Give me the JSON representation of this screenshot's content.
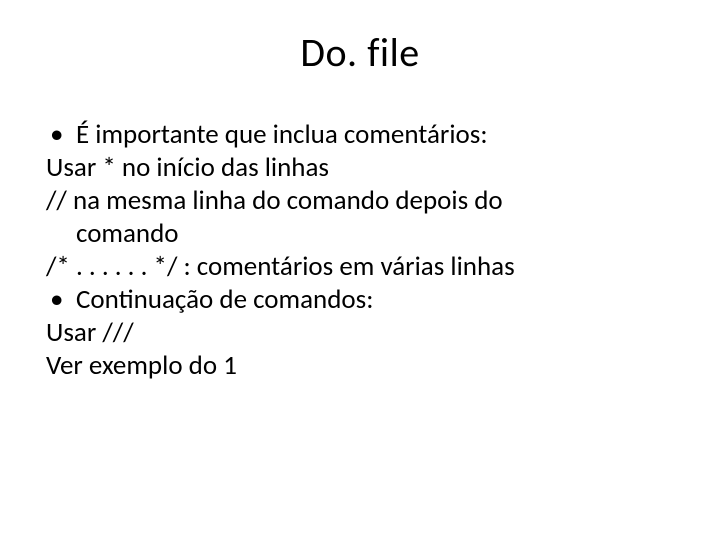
{
  "title": "Do. file",
  "lines": {
    "b1": "É importante que inclua comentários:",
    "l2": "Usar * no início das linhas",
    "l3": "// na mesma linha do comando depois do",
    "l3b": "comando",
    "l4": "/*   . . . . . .   */   : comentários em várias linhas",
    "b5": "Continuação de comandos:",
    "l6": "Usar ///",
    "l7": "Ver exemplo  do 1"
  },
  "bullet_glyph": "•"
}
